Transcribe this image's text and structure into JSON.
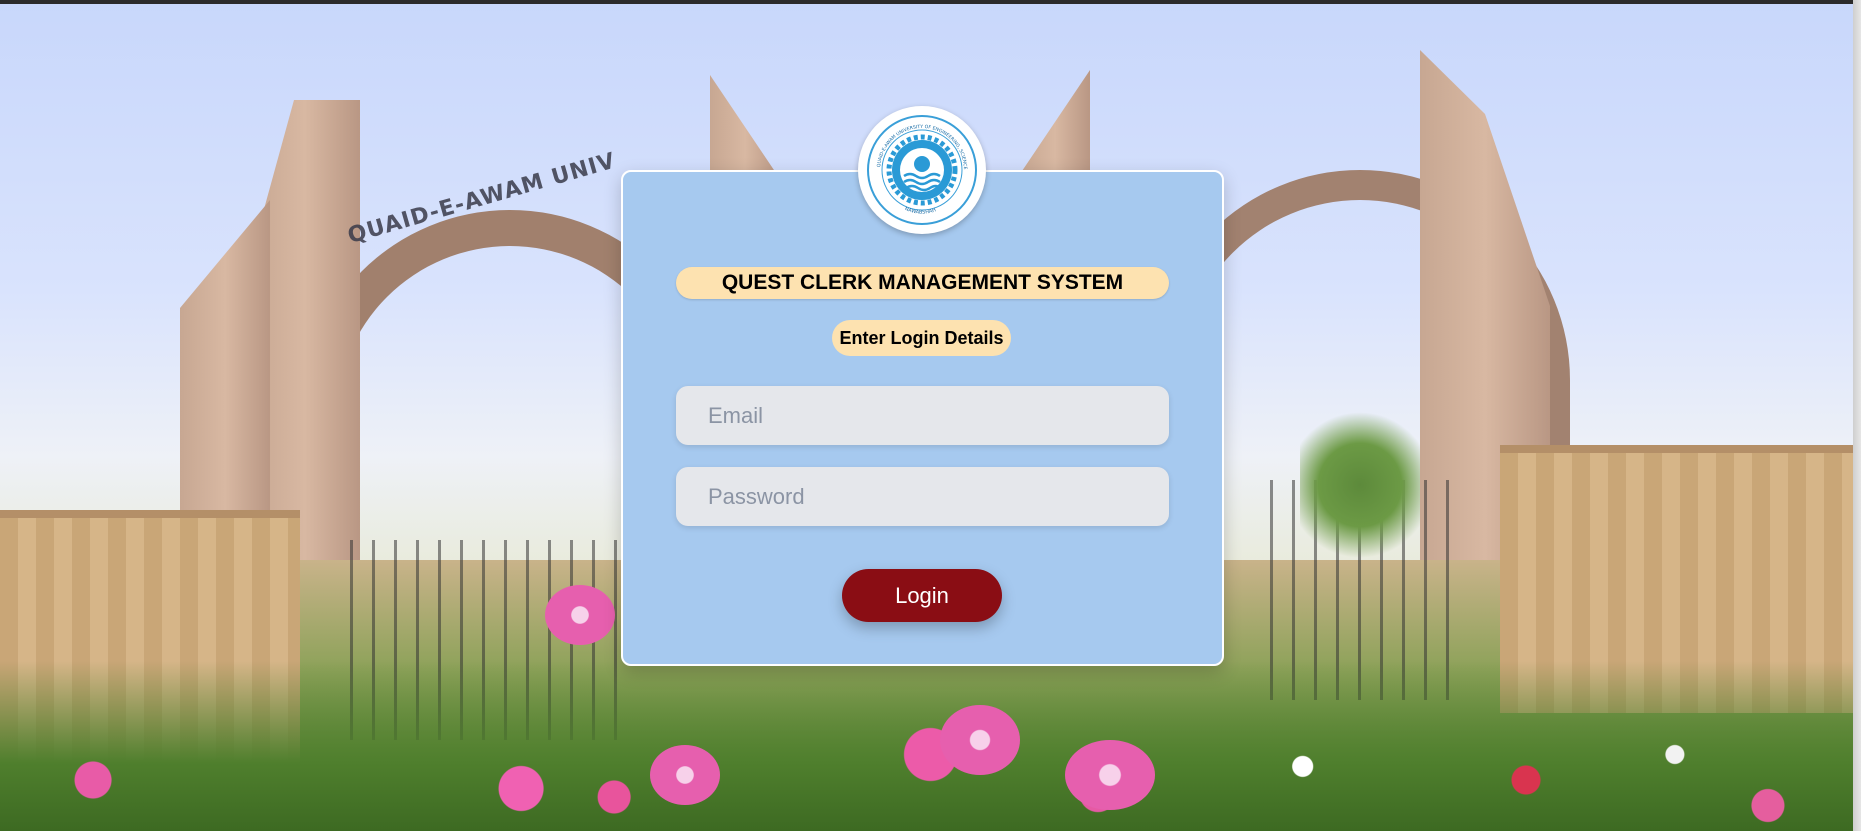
{
  "background": {
    "scene": "university-gate-photo",
    "arch_inscription": "QUAID-E-AWAM UNIV"
  },
  "logo": {
    "icon": "university-seal-icon",
    "seal_text": "QUAID-E-AWAM UNIVERSITY OF ENGINEERING, SCIENCE & TECHNOLOGY",
    "seal_footer": "NAWABSHAH"
  },
  "login": {
    "title": "QUEST CLERK MANAGEMENT SYSTEM",
    "subtitle": "Enter Login Details",
    "email_placeholder": "Email",
    "email_value": "",
    "password_placeholder": "Password",
    "password_value": "",
    "button_label": "Login"
  },
  "colors": {
    "card_background": "#a6c9ef",
    "pill_background": "#fde2b0",
    "button_background": "#8a0d14",
    "input_background": "#e5e7eb"
  }
}
